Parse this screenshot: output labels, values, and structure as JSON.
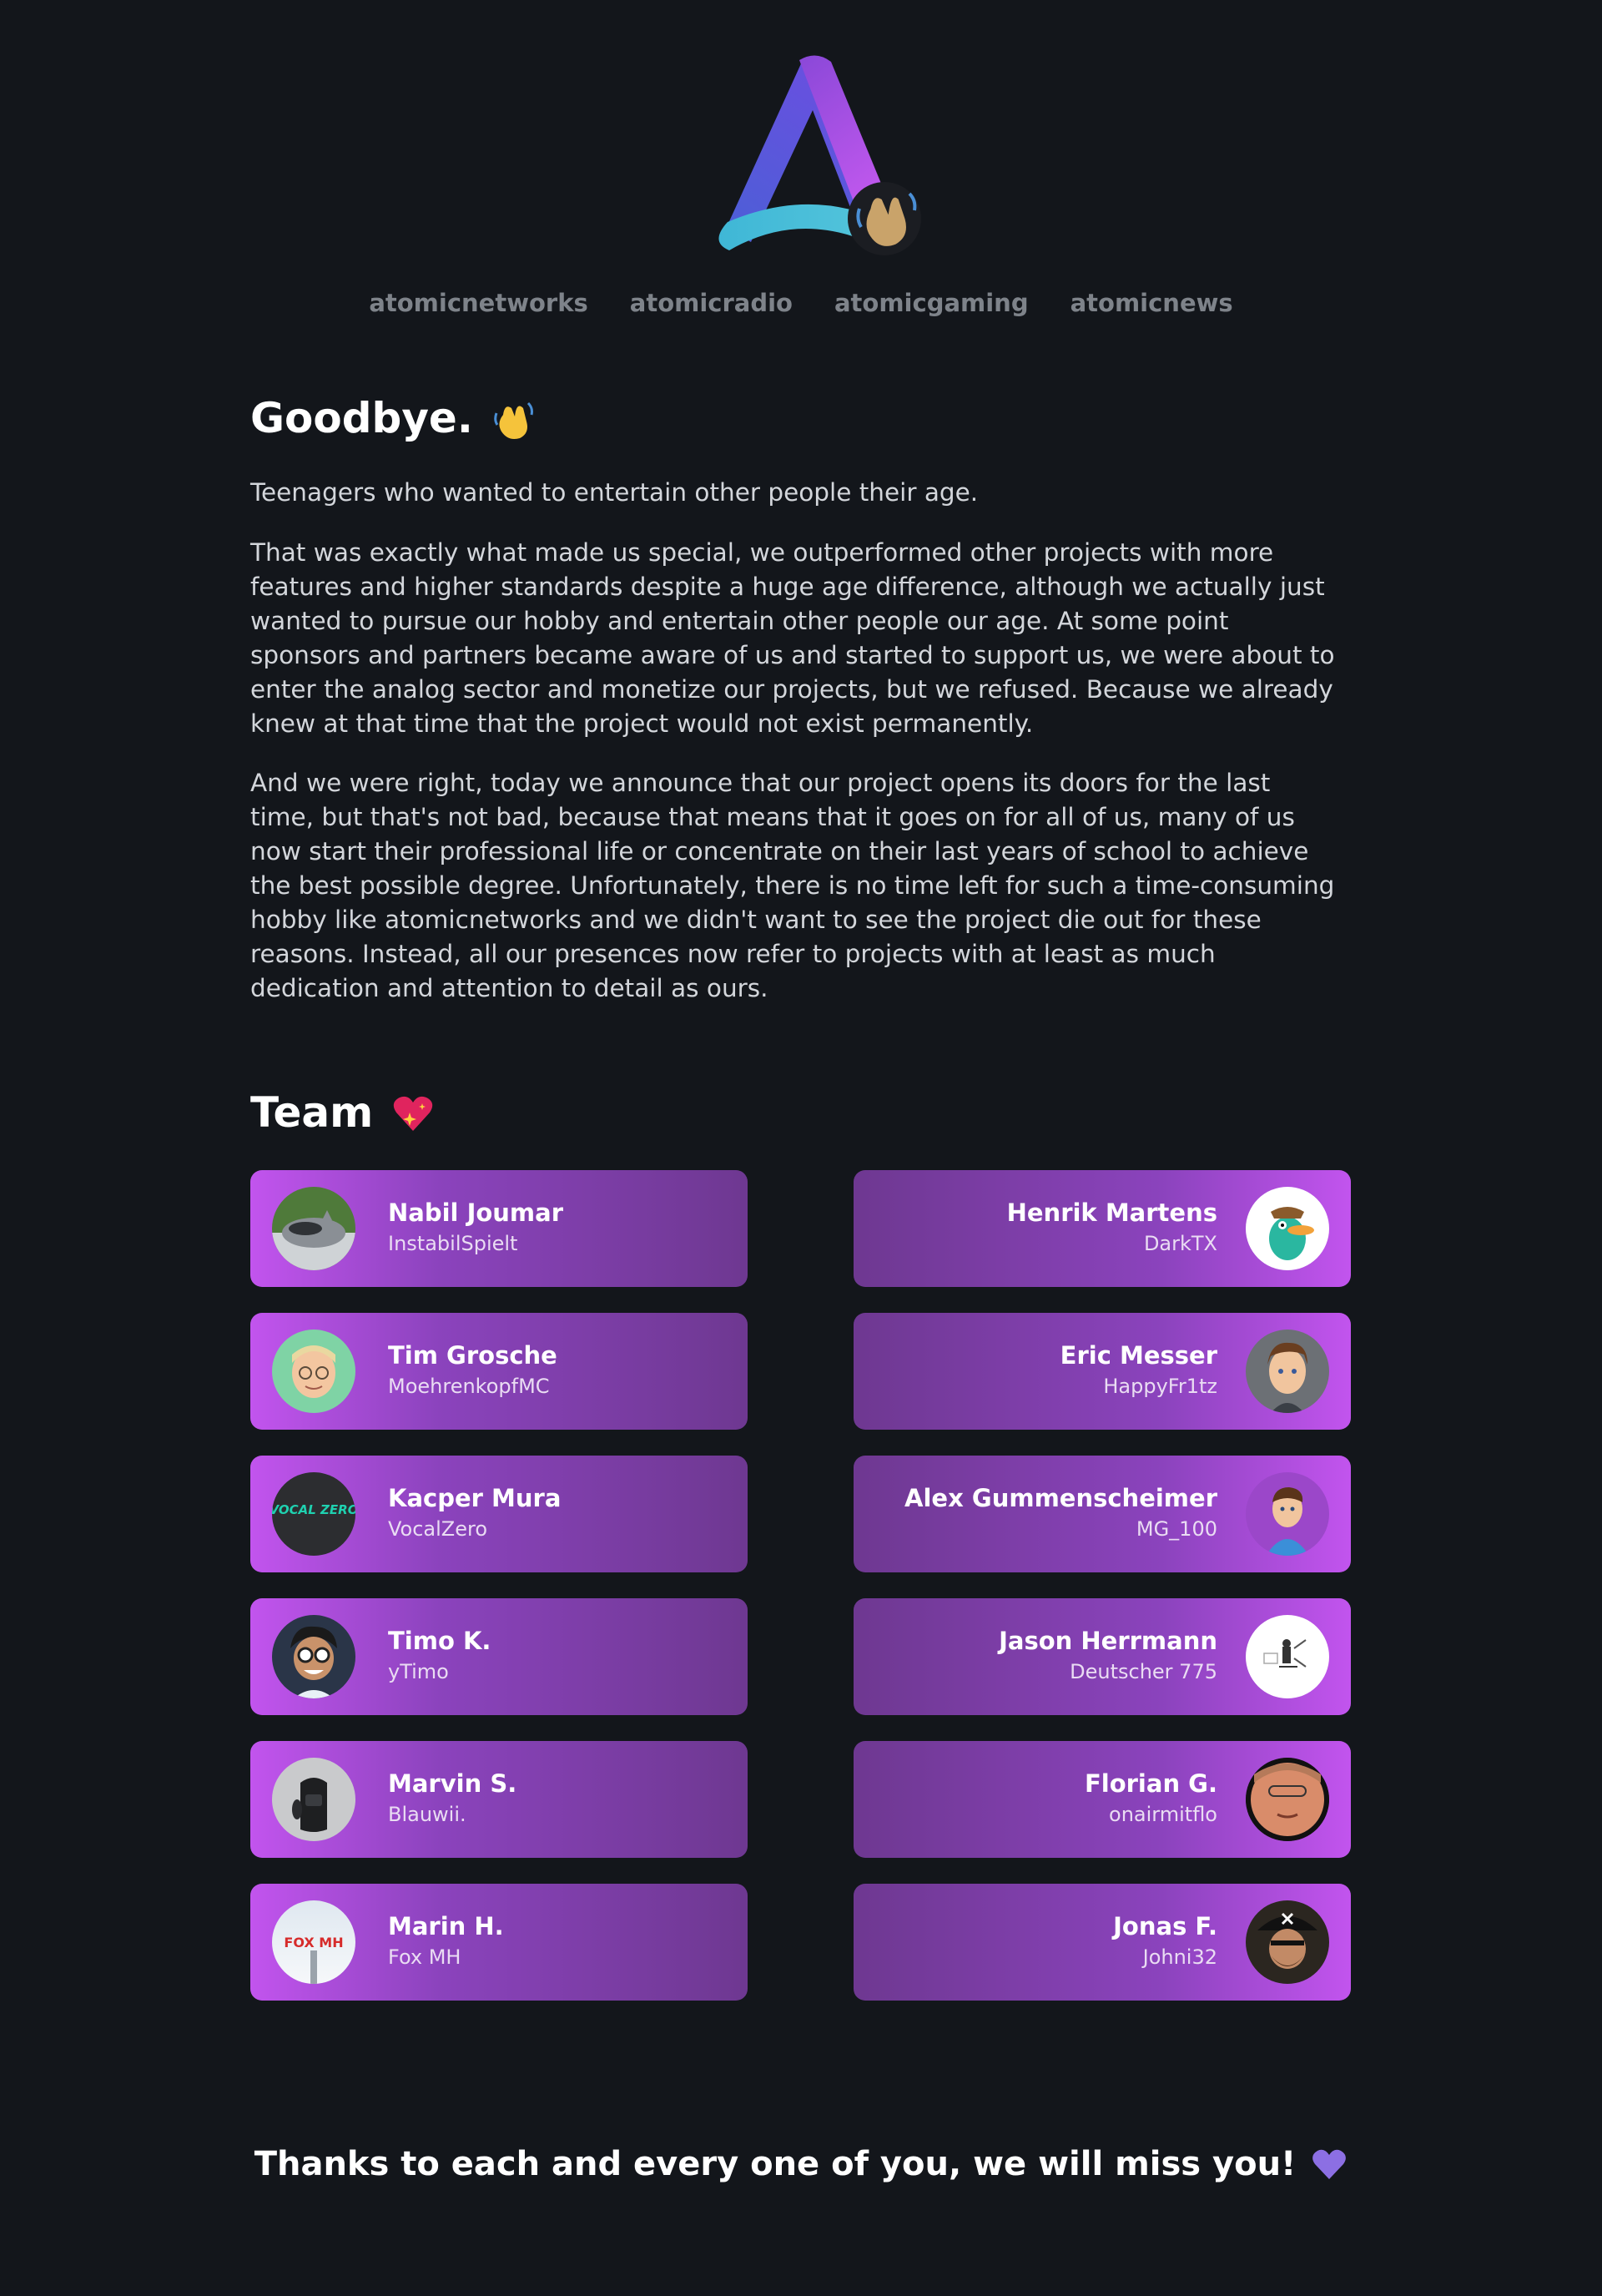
{
  "brand": {
    "accent": "#c254ee",
    "background": "#13161b",
    "logo_icon": "atomic-logo-icon",
    "waving_icon": "waving-hand-icon"
  },
  "nav": [
    {
      "label": "atomicnetworks"
    },
    {
      "label": "atomicradio"
    },
    {
      "label": "atomicgaming"
    },
    {
      "label": "atomicnews"
    }
  ],
  "goodbye": {
    "title": "Goodbye.",
    "icon": "waving-hand-icon",
    "paragraphs": [
      "Teenagers who wanted to entertain other people their age.",
      "That was exactly what made us special, we outperformed other projects with more features and higher standards despite a huge age difference, although we actually just wanted to pursue our hobby and entertain other people our age. At some point sponsors and partners became aware of us and started to support us, we were about to enter the analog sector and monetize our projects, but we refused. Because we already knew at that time that the project would not exist permanently.",
      "And we were right, today we announce that our project opens its doors for the last time, but that's not bad, because that means that it goes on for all of us, many of us now start their professional life or concentrate on their last years of school to achieve the best possible degree. Unfortunately, there is no time left for such a time-consuming hobby like atomicnetworks and we didn't want to see the project die out for these reasons. Instead, all our presences now refer to projects with at least as much dedication and attention to detail as ours."
    ]
  },
  "team": {
    "title": "Team",
    "icon": "sparkling-heart-icon",
    "members": [
      {
        "name": "Nabil Joumar",
        "handle": "InstabilSpielt",
        "avatar": "cat-avatar"
      },
      {
        "name": "Henrik Martens",
        "handle": "DarkTX",
        "avatar": "platypus-avatar"
      },
      {
        "name": "Tim Grosche",
        "handle": "MoehrenkopfMC",
        "avatar": "glasses-man-avatar"
      },
      {
        "name": "Eric Messer",
        "handle": "HappyFr1tz",
        "avatar": "cartoon-man-avatar"
      },
      {
        "name": "Kacper Mura",
        "handle": "VocalZero",
        "avatar": "vocalzero-logo-avatar",
        "avatar_text": "VOCAL ZERO"
      },
      {
        "name": "Alex Gummenscheimer",
        "handle": "MG_100",
        "avatar": "cartoon-man-blue-shirt-avatar"
      },
      {
        "name": "Timo K.",
        "handle": "yTimo",
        "avatar": "cartoon-glasses-avatar"
      },
      {
        "name": "Jason Herrmann",
        "handle": "Deutscher 775",
        "avatar": "sketch-avatar"
      },
      {
        "name": "Marvin S.",
        "handle": "Blauwii.",
        "avatar": "backpack-avatar"
      },
      {
        "name": "Florian G.",
        "handle": "onairmitflo",
        "avatar": "photo-man-avatar"
      },
      {
        "name": "Marin H.",
        "handle": "Fox MH",
        "avatar": "foxmh-logo-avatar",
        "avatar_text": "FOX MH"
      },
      {
        "name": "Jonas F.",
        "handle": "Johni32",
        "avatar": "pirate-avatar"
      }
    ]
  },
  "footer": {
    "text": "Thanks to each and every one of you, we will miss you!",
    "icon": "purple-heart-icon"
  }
}
